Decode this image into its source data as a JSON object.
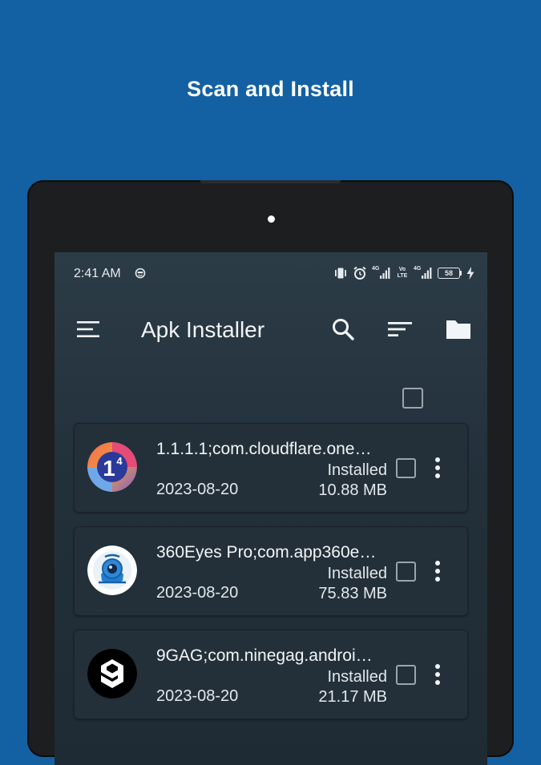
{
  "promo": {
    "title": "Scan and Install"
  },
  "status_bar": {
    "time": "2:41 AM",
    "network_1": "4G",
    "volte": "Vo LTE",
    "network_2": "4G",
    "battery": "58",
    "icons": [
      "face-icon",
      "vibrate-icon",
      "alarm-icon",
      "signal-icon",
      "signal-icon",
      "battery-icon",
      "charging-icon"
    ]
  },
  "app_bar": {
    "title": "Apk Installer",
    "icons": [
      "menu-icon",
      "search-icon",
      "sort-icon",
      "folder-icon"
    ]
  },
  "apps": [
    {
      "name": "1.1.1.1;com.cloudflare.one…",
      "status": "Installed",
      "date": "2023-08-20",
      "size": "10.88 MB"
    },
    {
      "name": "360Eyes Pro;com.app360e…",
      "status": "Installed",
      "date": "2023-08-20",
      "size": "75.83 MB"
    },
    {
      "name": "9GAG;com.ninegag.androi…",
      "status": "Installed",
      "date": "2023-08-20",
      "size": "21.17 MB"
    }
  ],
  "colors": {
    "background": "#1360a3",
    "tablet_bezel": "#1d1e1f",
    "screen": "#263540",
    "card": "#233039",
    "text": "#f2f5f7"
  }
}
